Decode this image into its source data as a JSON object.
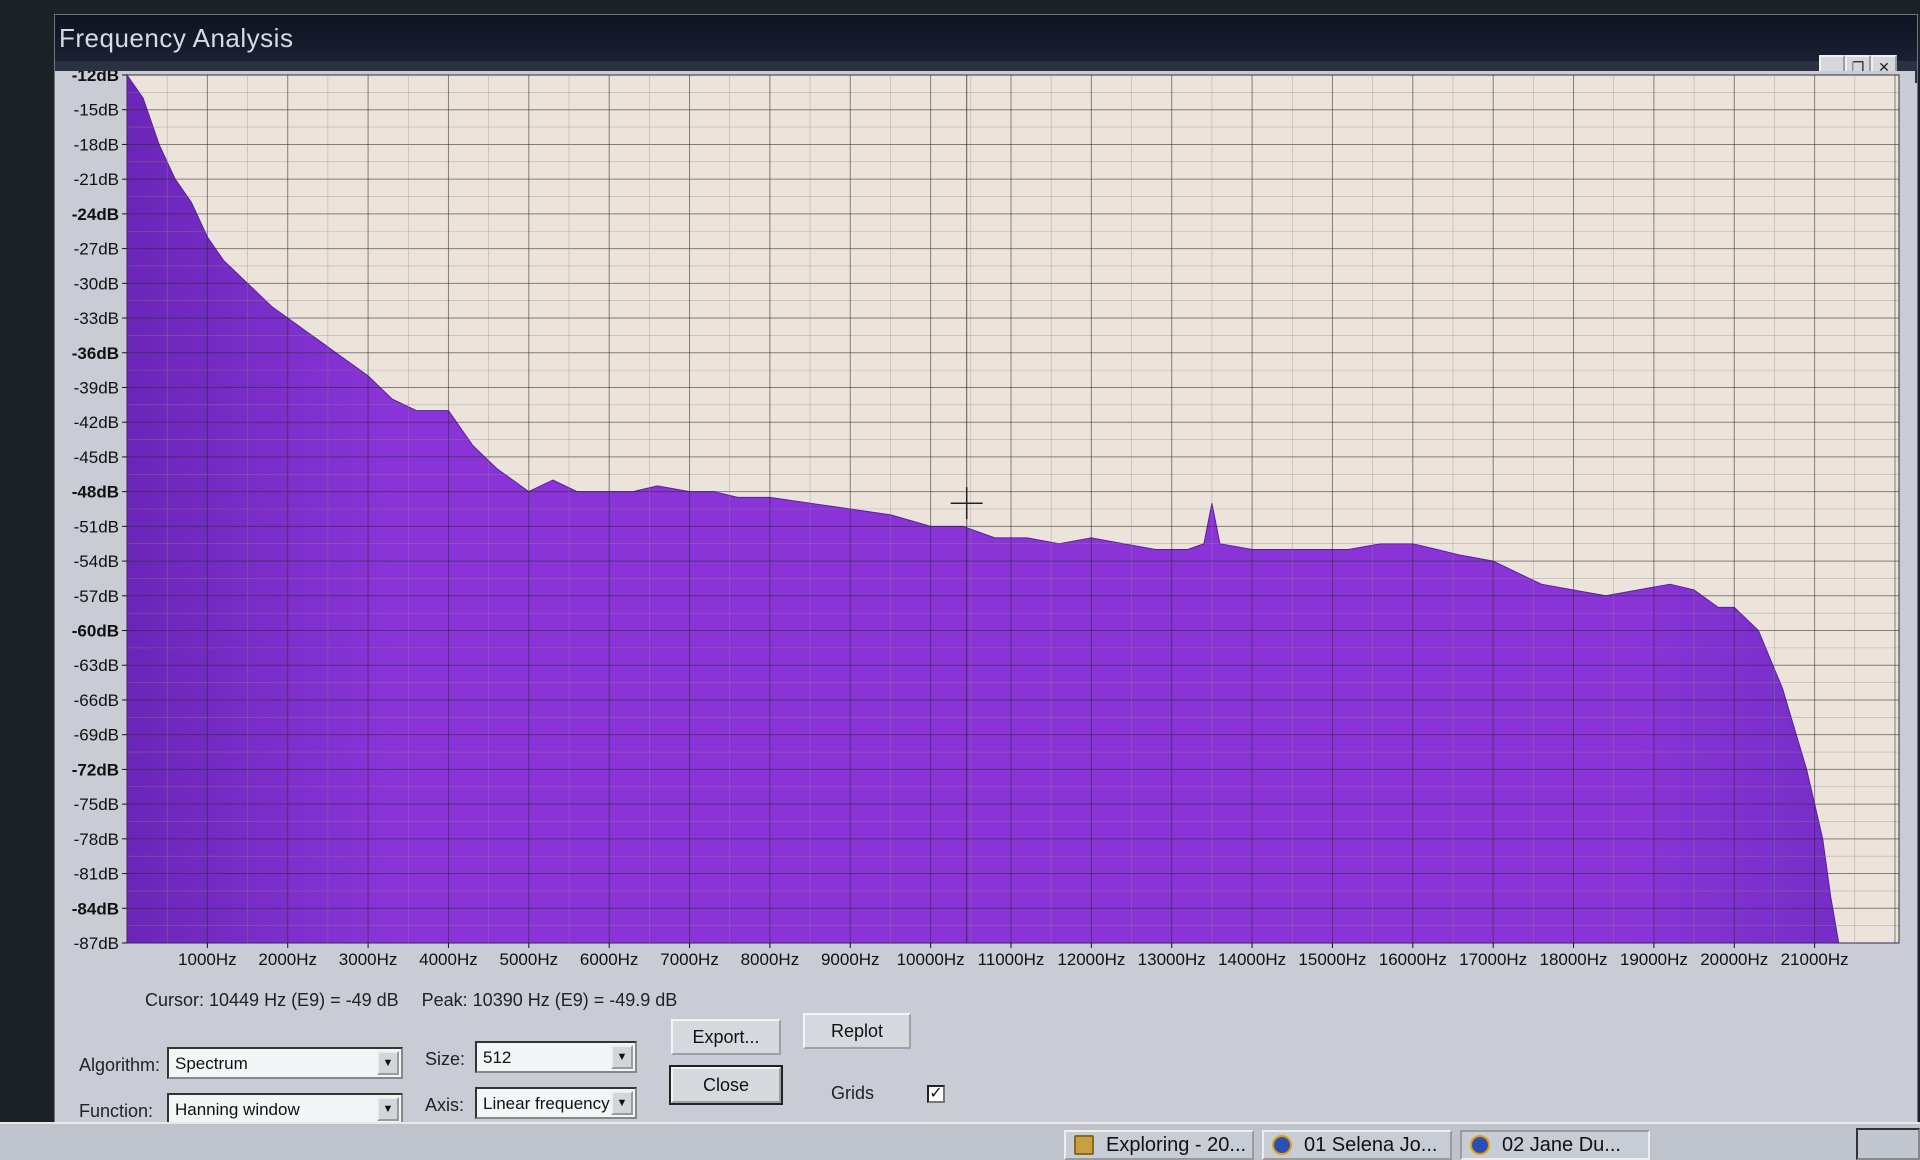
{
  "window": {
    "title": "Frequency Analysis",
    "minimize_glyph": "_",
    "restore_glyph": "❐",
    "close_glyph": "✕"
  },
  "chart_data": {
    "type": "area",
    "title": "",
    "xlabel": "",
    "ylabel": "",
    "xlim": [
      0,
      22050
    ],
    "ylim": [
      -87,
      -12
    ],
    "grid": true,
    "fill_color": "#8a34d8",
    "background_color": "#ece4da",
    "y_ticks": [
      "-12dB",
      "-15dB",
      "-18dB",
      "-21dB",
      "-24dB",
      "-27dB",
      "-30dB",
      "-33dB",
      "-36dB",
      "-39dB",
      "-42dB",
      "-45dB",
      "-48dB",
      "-51dB",
      "-54dB",
      "-57dB",
      "-60dB",
      "-63dB",
      "-66dB",
      "-69dB",
      "-72dB",
      "-75dB",
      "-78dB",
      "-81dB",
      "-84dB",
      "-87dB"
    ],
    "x_ticks": [
      "1000Hz",
      "2000Hz",
      "3000Hz",
      "4000Hz",
      "5000Hz",
      "6000Hz",
      "7000Hz",
      "8000Hz",
      "9000Hz",
      "10000Hz",
      "11000Hz",
      "12000Hz",
      "13000Hz",
      "14000Hz",
      "15000Hz",
      "16000Hz",
      "17000Hz",
      "18000Hz",
      "19000Hz",
      "20000Hz",
      "21000Hz"
    ],
    "x": [
      0,
      200,
      400,
      600,
      800,
      1000,
      1200,
      1500,
      1800,
      2000,
      2200,
      2400,
      2600,
      2800,
      3000,
      3300,
      3600,
      4000,
      4300,
      4600,
      5000,
      5300,
      5600,
      6000,
      6300,
      6600,
      7000,
      7300,
      7600,
      8000,
      8500,
      9000,
      9500,
      10000,
      10400,
      10800,
      11200,
      11600,
      12000,
      12400,
      12800,
      13200,
      13400,
      13500,
      13600,
      14000,
      14400,
      14800,
      15200,
      15600,
      16000,
      16300,
      16600,
      17000,
      17300,
      17600,
      18000,
      18400,
      18800,
      19200,
      19500,
      19800,
      20000,
      20300,
      20600,
      20900,
      21100,
      21200,
      21300,
      21400,
      22050
    ],
    "y": [
      -12,
      -14,
      -18,
      -21,
      -23,
      -26,
      -28,
      -30,
      -32,
      -33,
      -34,
      -35,
      -36,
      -37,
      -38,
      -40,
      -41,
      -41,
      -44,
      -46,
      -48,
      -47,
      -48,
      -48,
      -48,
      -47.5,
      -48,
      -48,
      -48.5,
      -48.5,
      -49,
      -49.5,
      -50,
      -51,
      -51,
      -52,
      -52,
      -52.5,
      -52,
      -52.5,
      -53,
      -53,
      -52.5,
      -49,
      -52.5,
      -53,
      -53,
      -53,
      -53,
      -52.5,
      -52.5,
      -53,
      -53.5,
      -54,
      -55,
      -56,
      -56.5,
      -57,
      -56.5,
      -56,
      -56.5,
      -58,
      -58,
      -60,
      -65,
      -72,
      -78,
      -83,
      -87,
      -87,
      -87
    ]
  },
  "status": {
    "cursor": "Cursor: 10449 Hz (E9) = -49 dB",
    "peak": "Peak: 10390 Hz (E9) = -49.9 dB"
  },
  "controls": {
    "algorithm_label": "Algorithm:",
    "algorithm_value": "Spectrum",
    "function_label": "Function:",
    "function_value": "Hanning window",
    "size_label": "Size:",
    "size_value": "512",
    "axis_label": "Axis:",
    "axis_value": "Linear frequency",
    "export_label": "Export...",
    "replot_label": "Replot",
    "close_label": "Close",
    "grids_label": "Grids",
    "grids_checked": "✓",
    "dropdown_arrow": "▼"
  },
  "taskbar": {
    "items": [
      "Exploring - 20...",
      "01 Selena Jo...",
      "02 Jane Du..."
    ]
  }
}
